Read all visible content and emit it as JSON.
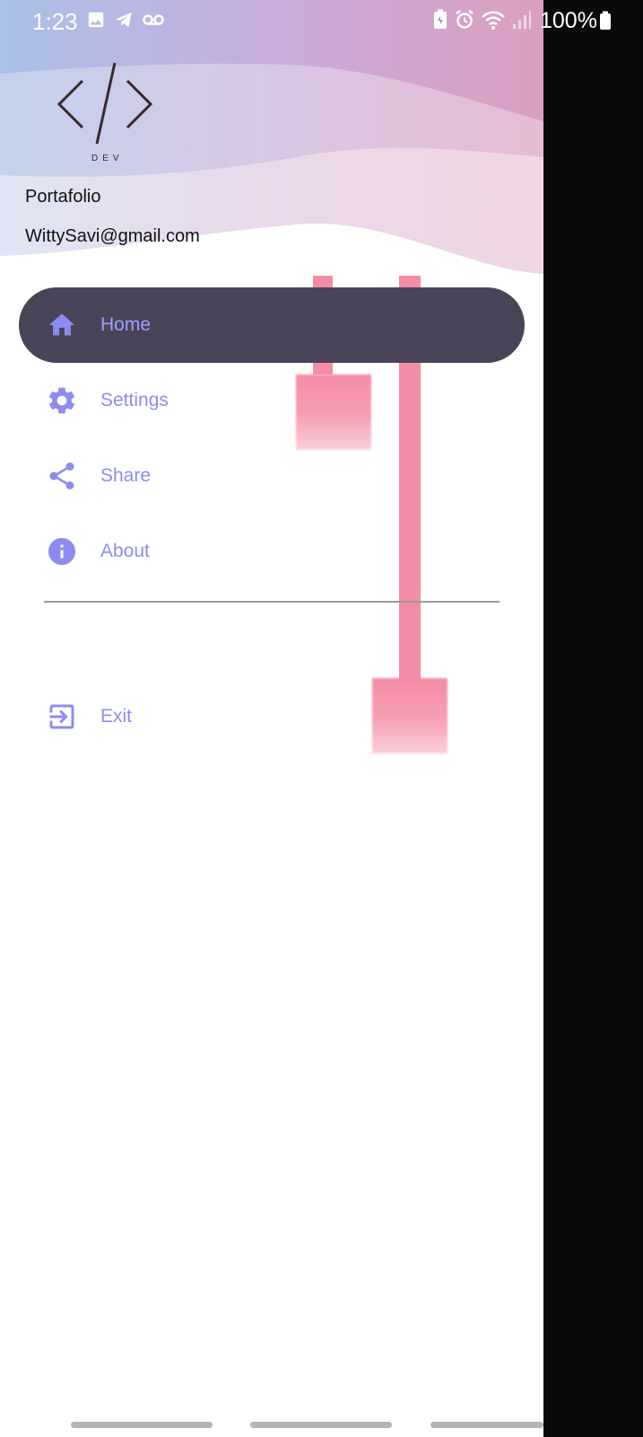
{
  "status_bar": {
    "time": "1:23",
    "battery": "100%",
    "left_icons": [
      "image-icon",
      "telegram-icon",
      "voicemail-icon"
    ],
    "right_icons": [
      "battery-saver-icon",
      "alarm-icon",
      "wifi-icon",
      "signal-icon",
      "battery-icon"
    ]
  },
  "header": {
    "logo_caption": "DEV",
    "title": "Portafolio",
    "email": "WittySavi@gmail.com"
  },
  "menu": {
    "items": [
      {
        "label": "Home",
        "icon": "home-icon",
        "selected": true
      },
      {
        "label": "Settings",
        "icon": "gear-icon",
        "selected": false
      },
      {
        "label": "Share",
        "icon": "share-icon",
        "selected": false
      },
      {
        "label": "About",
        "icon": "info-icon",
        "selected": false
      }
    ],
    "exit": {
      "label": "Exit",
      "icon": "exit-icon"
    }
  },
  "colors": {
    "accent": "#8c8cef",
    "selected_bg": "#4a4458",
    "scrim": "#0a0a0c",
    "app_bar": "#383a62",
    "decor_pink": "#f48ca5"
  }
}
